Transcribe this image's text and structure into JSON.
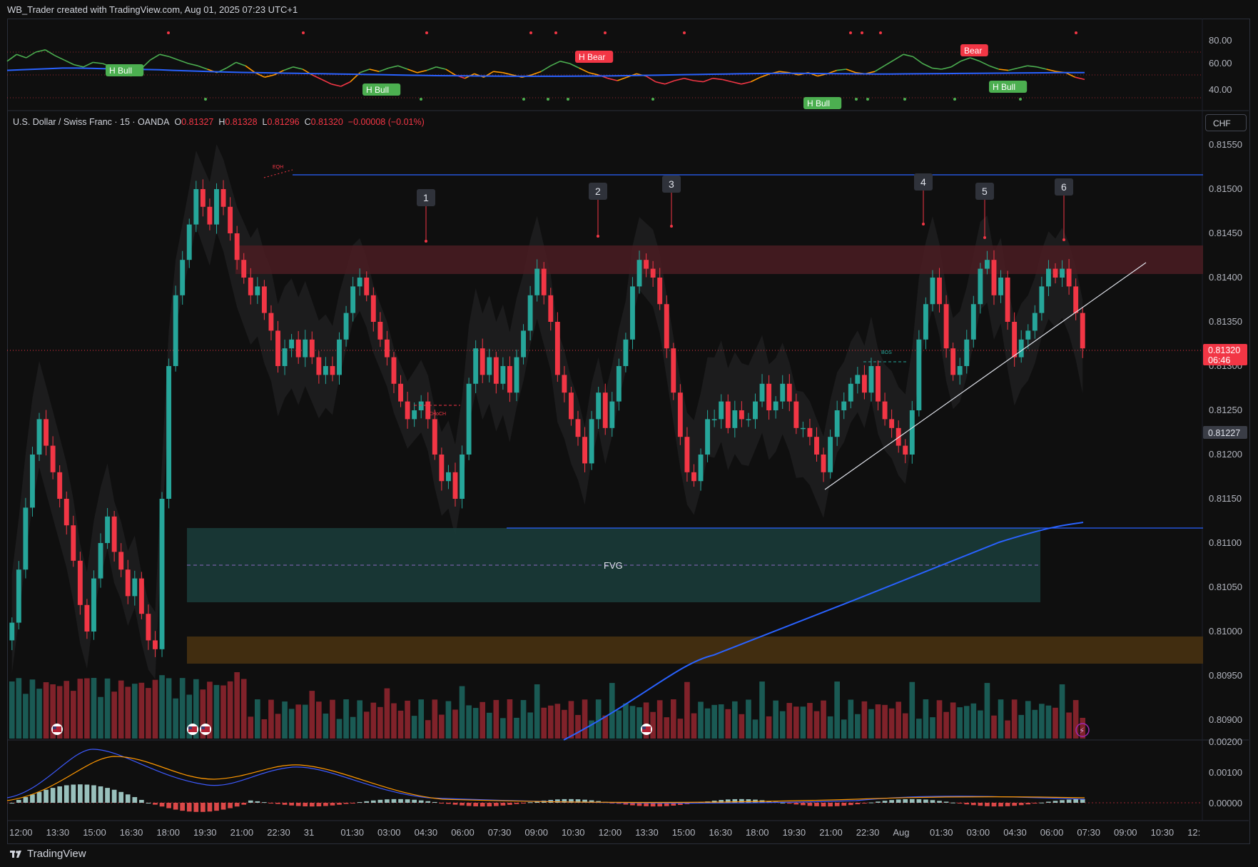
{
  "header": {
    "caption": "WB_Trader created with TradingView.com, Aug 01, 2025 07:23 UTC+1"
  },
  "footer": {
    "brand": "TradingView"
  },
  "symbol": {
    "name": "U.S. Dollar / Swiss Franc · 15 · OANDA",
    "o_label": "O",
    "o": "0.81327",
    "h_label": "H",
    "h": "0.81328",
    "l_label": "L",
    "l": "0.81296",
    "c_label": "C",
    "c": "0.81320",
    "change": "−0.00008 (−0.01%)"
  },
  "currency_button": "CHF",
  "colors": {
    "up": "#26a69a",
    "down": "#f23645",
    "ma_blue": "#2962ff",
    "fvg": "#1a3b38",
    "supply": "#4a1c22",
    "demand": "#4a3210"
  },
  "chart_data": {
    "type": "candlestick",
    "price_axis": {
      "ticks": [
        "0.81550",
        "0.81500",
        "0.81450",
        "0.81400",
        "0.81350",
        "0.81300",
        "0.81250",
        "0.81200",
        "0.81150",
        "0.81100",
        "0.81050",
        "0.81000",
        "0.80950",
        "0.80900"
      ],
      "last_price": "0.81320",
      "countdown": "06:46",
      "marked_level": "0.81227"
    },
    "time_axis": [
      "12:00",
      "13:30",
      "15:00",
      "16:30",
      "18:00",
      "19:30",
      "21:00",
      "22:30",
      "31",
      "01:30",
      "03:00",
      "04:30",
      "06:00",
      "07:30",
      "09:00",
      "10:30",
      "12:00",
      "13:30",
      "15:00",
      "16:30",
      "18:00",
      "19:30",
      "21:00",
      "22:30",
      "Aug",
      "01:30",
      "03:00",
      "04:30",
      "06:00",
      "07:30",
      "09:00",
      "10:30",
      "12:"
    ],
    "close_series": [
      0.8101,
      0.8107,
      0.8114,
      0.812,
      0.8124,
      0.8121,
      0.8118,
      0.8115,
      0.8112,
      0.8108,
      0.8103,
      0.81,
      0.8106,
      0.811,
      0.8113,
      0.8109,
      0.8107,
      0.8104,
      0.8106,
      0.8102,
      0.8099,
      0.8098,
      0.8115,
      0.813,
      0.8138,
      0.8142,
      0.8146,
      0.815,
      0.8148,
      0.8146,
      0.815,
      0.8148,
      0.8145,
      0.8142,
      0.814,
      0.8138,
      0.8139,
      0.8136,
      0.8134,
      0.813,
      0.8132,
      0.8133,
      0.8131,
      0.8133,
      0.8131,
      0.8129,
      0.813,
      0.8129,
      0.8133,
      0.8136,
      0.8139,
      0.814,
      0.8138,
      0.8135,
      0.8133,
      0.8131,
      0.8128,
      0.8126,
      0.8124,
      0.8125,
      0.8126,
      0.8124,
      0.812,
      0.8117,
      0.8118,
      0.8115,
      0.812,
      0.8128,
      0.8132,
      0.8129,
      0.8131,
      0.8128,
      0.813,
      0.8127,
      0.8131,
      0.8134,
      0.8138,
      0.8141,
      0.8138,
      0.8135,
      0.8129,
      0.8127,
      0.8124,
      0.8122,
      0.8119,
      0.8124,
      0.8127,
      0.8123,
      0.8126,
      0.813,
      0.8133,
      0.8139,
      0.8142,
      0.8141,
      0.814,
      0.8137,
      0.8132,
      0.8127,
      0.8122,
      0.8118,
      0.8117,
      0.812,
      0.8124,
      0.8124,
      0.8126,
      0.8123,
      0.8125,
      0.8124,
      0.8124,
      0.8126,
      0.8128,
      0.8125,
      0.8126,
      0.8128,
      0.8126,
      0.8123,
      0.8123,
      0.8122,
      0.812,
      0.8118,
      0.8122,
      0.8125,
      0.8126,
      0.8128,
      0.8129,
      0.8127,
      0.813,
      0.8126,
      0.8124,
      0.8123,
      0.8121,
      0.812,
      0.8125,
      0.8133,
      0.8137,
      0.814,
      0.8137,
      0.8132,
      0.8129,
      0.813,
      0.8133,
      0.8137,
      0.8141,
      0.8142,
      0.8138,
      0.814,
      0.8135,
      0.8131,
      0.8133,
      0.8134,
      0.8136,
      0.8139,
      0.8141,
      0.814,
      0.8141,
      0.8139,
      0.8136,
      0.8132
    ],
    "annotations": {
      "swing_labels": [
        "1",
        "2",
        "3",
        "4",
        "5",
        "6"
      ],
      "fvg_label": "FVG",
      "eqh_label": "EQH",
      "choch_label": "CHoCH",
      "bos_label": "BOS"
    },
    "rsi_panel": {
      "ticks": [
        "80.00",
        "60.00",
        "40.00"
      ],
      "labels": [
        "H Bull",
        "H Bull",
        "H Bear",
        "H Bull",
        "Bear",
        "H Bull"
      ],
      "rsi": [
        62,
        68,
        65,
        70,
        72,
        67,
        63,
        59,
        57,
        61,
        60,
        57,
        52,
        49,
        55,
        63,
        68,
        66,
        63,
        60,
        58,
        55,
        52,
        56,
        61,
        58,
        52,
        48,
        50,
        54,
        57,
        55,
        50,
        46,
        42,
        40,
        44,
        52,
        55,
        53,
        56,
        58,
        55,
        52,
        54,
        57,
        55,
        50,
        47,
        51,
        48,
        53,
        52,
        50,
        48,
        50,
        53,
        58,
        62,
        60,
        56,
        52,
        50,
        47,
        45,
        48,
        51,
        49,
        44,
        42,
        45,
        47,
        45,
        44,
        47,
        46,
        44,
        42,
        44,
        48,
        51,
        53,
        52,
        50,
        52,
        49,
        51,
        54,
        55,
        52,
        51,
        53,
        58,
        63,
        68,
        66,
        60,
        56,
        55,
        57,
        62,
        65,
        62,
        58,
        55,
        54,
        56,
        58,
        57,
        55,
        53,
        52,
        48,
        46
      ],
      "signal": [
        54,
        54.5,
        55,
        55.5,
        56,
        56,
        55.8,
        55.5,
        55.2,
        55,
        54.8,
        54.5,
        54,
        53.6,
        53.2,
        52.8,
        52.5,
        52.2,
        52,
        51.8,
        51.6,
        51.4,
        51.2,
        51,
        50.8,
        50.6,
        50.4,
        50.2,
        50,
        49.8,
        49.6,
        49.4,
        49.3,
        49.2,
        49.1,
        49,
        48.9,
        48.8,
        48.8,
        48.8,
        48.8,
        48.9,
        49,
        49.1,
        49.2,
        49.4,
        49.6,
        49.8,
        50,
        50.2,
        50.4,
        50.6,
        50.8,
        51,
        51.2,
        51.3,
        51.4,
        51.4,
        51.3,
        51.2,
        51.1,
        51,
        50.9,
        50.8,
        50.8,
        50.9,
        51,
        51.1,
        51.2,
        51.3,
        51.4,
        51.5,
        51.6,
        51.7,
        51.8,
        51.9,
        52,
        52,
        52
      ]
    },
    "macd_panel": {
      "ticks": [
        "0.00200",
        "0.00100",
        "0.00000"
      ]
    }
  }
}
